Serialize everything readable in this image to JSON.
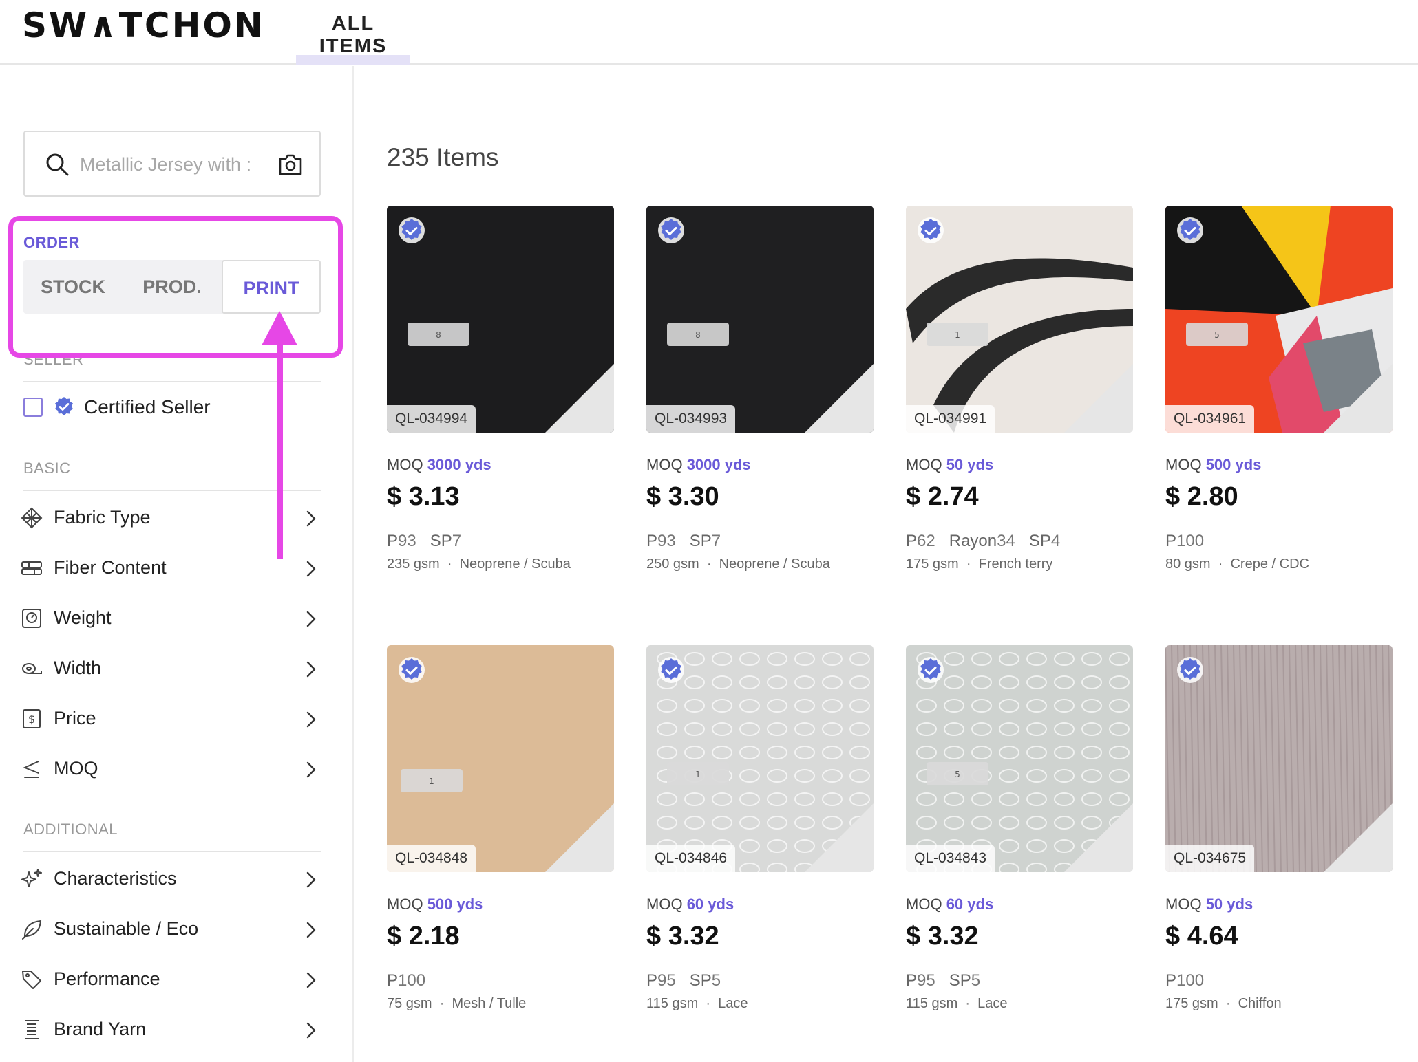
{
  "header": {
    "logo": "SW∧TCHON",
    "tab_label": "ALL ITEMS"
  },
  "search": {
    "placeholder": "Metallic Jersey with :"
  },
  "order": {
    "label": "ORDER",
    "options": [
      "STOCK",
      "PROD.",
      "PRINT"
    ],
    "selected": "PRINT"
  },
  "seller": {
    "label": "SELLER",
    "certified_label": "Certified Seller",
    "checked": false
  },
  "basic": {
    "label": "BASIC",
    "filters": [
      {
        "label": "Fabric Type",
        "icon": "fabric-type-icon"
      },
      {
        "label": "Fiber Content",
        "icon": "fiber-content-icon"
      },
      {
        "label": "Weight",
        "icon": "weight-icon"
      },
      {
        "label": "Width",
        "icon": "width-icon"
      },
      {
        "label": "Price",
        "icon": "price-icon"
      },
      {
        "label": "MOQ",
        "icon": "moq-icon"
      }
    ]
  },
  "additional": {
    "label": "ADDITIONAL",
    "filters": [
      {
        "label": "Characteristics",
        "icon": "sparkle-icon"
      },
      {
        "label": "Sustainable / Eco",
        "icon": "leaf-icon"
      },
      {
        "label": "Performance",
        "icon": "tag-icon"
      },
      {
        "label": "Brand Yarn",
        "icon": "yarn-icon"
      }
    ]
  },
  "results": {
    "count_label": "235 Items",
    "items": [
      {
        "code": "QL-034994",
        "moq_prefix": "MOQ",
        "moq_value": "3000 yds",
        "price": "$ 3.13",
        "composition": [
          [
            "P",
            "93"
          ],
          [
            "SP",
            "7"
          ]
        ],
        "weight": "235 gsm",
        "type": "Neoprene / Scuba",
        "swatch_color": "#1c1c1e",
        "swatch_label": "8"
      },
      {
        "code": "QL-034993",
        "moq_prefix": "MOQ",
        "moq_value": "3000 yds",
        "price": "$ 3.30",
        "composition": [
          [
            "P",
            "93"
          ],
          [
            "SP",
            "7"
          ]
        ],
        "weight": "250 gsm",
        "type": "Neoprene / Scuba",
        "swatch_color": "#1f1f21",
        "swatch_label": "8"
      },
      {
        "code": "QL-034991",
        "moq_prefix": "MOQ",
        "moq_value": "50 yds",
        "price": "$ 2.74",
        "composition": [
          [
            "P",
            "62"
          ],
          [
            "Rayon",
            "34"
          ],
          [
            "SP",
            "4"
          ]
        ],
        "weight": "175 gsm",
        "type": "French terry",
        "swatch_color": "#ebe6e1",
        "swatch_label": "1"
      },
      {
        "code": "QL-034961",
        "moq_prefix": "MOQ",
        "moq_value": "500 yds",
        "price": "$ 2.80",
        "composition": [
          [
            "P",
            "100"
          ]
        ],
        "weight": "80 gsm",
        "type": "Crepe / CDC",
        "swatch_color": "#ee4422",
        "swatch_label": "5"
      },
      {
        "code": "QL-034848",
        "moq_prefix": "MOQ",
        "moq_value": "500 yds",
        "price": "$ 2.18",
        "composition": [
          [
            "P",
            "100"
          ]
        ],
        "weight": "75 gsm",
        "type": "Mesh / Tulle",
        "swatch_color": "#dcbb97",
        "swatch_label": "1"
      },
      {
        "code": "QL-034846",
        "moq_prefix": "MOQ",
        "moq_value": "60 yds",
        "price": "$ 3.32",
        "composition": [
          [
            "P",
            "95"
          ],
          [
            "SP",
            "5"
          ]
        ],
        "weight": "115 gsm",
        "type": "Lace",
        "swatch_color": "#d9dad9",
        "swatch_label": "1"
      },
      {
        "code": "QL-034843",
        "moq_prefix": "MOQ",
        "moq_value": "60 yds",
        "price": "$ 3.32",
        "composition": [
          [
            "P",
            "95"
          ],
          [
            "SP",
            "5"
          ]
        ],
        "weight": "115 gsm",
        "type": "Lace",
        "swatch_color": "#cfd3d0",
        "swatch_label": "5"
      },
      {
        "code": "QL-034675",
        "moq_prefix": "MOQ",
        "moq_value": "50 yds",
        "price": "$ 4.64",
        "composition": [
          [
            "P",
            "100"
          ]
        ],
        "weight": "175 gsm",
        "type": "Chiffon",
        "swatch_color": "#b9adad",
        "swatch_label": ""
      }
    ]
  },
  "colors": {
    "accent": "#6a5ad8",
    "highlight": "#e647e6",
    "verified_badge": "#5a6ed8"
  }
}
